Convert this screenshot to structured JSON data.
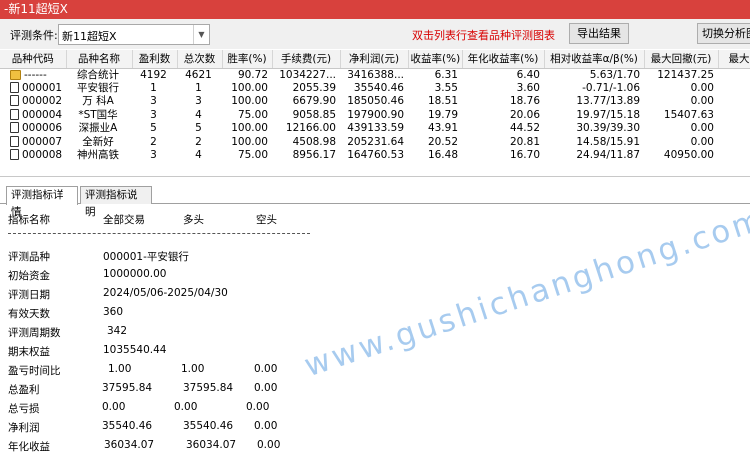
{
  "window": {
    "title": "-新11超短X"
  },
  "toolbar": {
    "condition_label": "评测条件:",
    "condition_value": "新11超短X",
    "hint": "双击列表行查看品种评测图表",
    "export_label": "导出结果",
    "switch_label": "切换分析图"
  },
  "grid": {
    "headers": [
      "品种代码",
      "品种名称",
      "盈利数",
      "总次数",
      "胜率(%)",
      "手续费(元)",
      "净利润(元)",
      "收益率(%)",
      "年化收益率(%)",
      "相对收益率α/β(%)",
      "最大回撤(元)",
      "最大"
    ],
    "rows": [
      {
        "code": "------",
        "name": "综合统计",
        "win": "4192",
        "total": "4621",
        "rate": "90.72",
        "fee": "1034227...",
        "profit": "3416388...",
        "ret": "6.31",
        "annual": "6.40",
        "rel": "5.63/1.70",
        "dd": "121437.25"
      },
      {
        "code": "000001",
        "name": "平安银行",
        "win": "1",
        "total": "1",
        "rate": "100.00",
        "fee": "2055.39",
        "profit": "35540.46",
        "ret": "3.55",
        "annual": "3.60",
        "rel": "-0.71/-1.06",
        "dd": "0.00"
      },
      {
        "code": "000002",
        "name": "万 科A",
        "win": "3",
        "total": "3",
        "rate": "100.00",
        "fee": "6679.90",
        "profit": "185050.46",
        "ret": "18.51",
        "annual": "18.76",
        "rel": "13.77/13.89",
        "dd": "0.00"
      },
      {
        "code": "000004",
        "name": "*ST国华",
        "win": "3",
        "total": "4",
        "rate": "75.00",
        "fee": "9058.85",
        "profit": "197900.90",
        "ret": "19.79",
        "annual": "20.06",
        "rel": "19.97/15.18",
        "dd": "15407.63"
      },
      {
        "code": "000006",
        "name": "深振业A",
        "win": "5",
        "total": "5",
        "rate": "100.00",
        "fee": "12166.00",
        "profit": "439133.59",
        "ret": "43.91",
        "annual": "44.52",
        "rel": "30.39/39.30",
        "dd": "0.00"
      },
      {
        "code": "000007",
        "name": "全新好",
        "win": "2",
        "total": "2",
        "rate": "100.00",
        "fee": "4508.98",
        "profit": "205231.64",
        "ret": "20.52",
        "annual": "20.81",
        "rel": "14.58/15.91",
        "dd": "0.00"
      },
      {
        "code": "000008",
        "name": "神州高铁",
        "win": "3",
        "total": "4",
        "rate": "75.00",
        "fee": "8956.17",
        "profit": "164760.53",
        "ret": "16.48",
        "annual": "16.70",
        "rel": "24.94/11.87",
        "dd": "40950.00"
      }
    ]
  },
  "tabs": [
    "评测指标详情",
    "评测指标说明"
  ],
  "detail": {
    "headers": [
      "指标名称",
      "全部交易",
      "多头",
      "空头"
    ],
    "info": [
      {
        "label": "评测品种",
        "value": "000001-平安银行"
      },
      {
        "label": "初始资金",
        "value": "1000000.00"
      },
      {
        "label": "评测日期",
        "value": "2024/05/06-2025/04/30"
      },
      {
        "label": "有效天数",
        "value": "360"
      },
      {
        "label": "评测周期数",
        "value": "342"
      },
      {
        "label": "期末权益",
        "value": "1035540.44"
      }
    ],
    "stats": [
      {
        "label": "盈亏时间比",
        "all": "1.00",
        "long": "1.00",
        "short": "0.00"
      },
      {
        "label": "总盈利",
        "all": "37595.84",
        "long": "37595.84",
        "short": "0.00"
      },
      {
        "label": "总亏损",
        "all": "0.00",
        "long": "0.00",
        "short": "0.00"
      },
      {
        "label": "净利润",
        "all": "35540.46",
        "long": "35540.46",
        "short": "0.00"
      },
      {
        "label": "年化收益",
        "all": "36034.07",
        "long": "36034.07",
        "short": "0.00"
      }
    ]
  },
  "watermark": "www.gushichanghong.com"
}
